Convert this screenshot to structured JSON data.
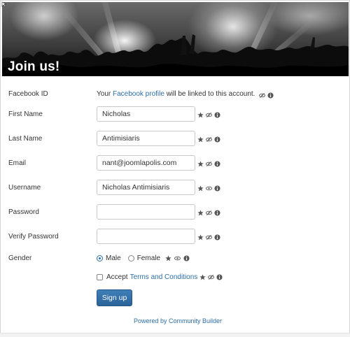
{
  "header": {
    "title": "Join us!",
    "back_icon": "back-arrow-icon"
  },
  "form": {
    "facebook": {
      "label": "Facebook ID",
      "prefix": "Your ",
      "link": "Facebook profile",
      "suffix": " will be linked to this account."
    },
    "fields": [
      {
        "label": "First Name",
        "value": "Nicholas"
      },
      {
        "label": "Last Name",
        "value": "Antimisiaris"
      },
      {
        "label": "Email",
        "value": "nant@joomlapolis.com"
      },
      {
        "label": "Username",
        "value": "Nicholas Antimisiaris"
      },
      {
        "label": "Password",
        "value": ""
      },
      {
        "label": "Verify Password",
        "value": ""
      }
    ],
    "gender": {
      "label": "Gender",
      "options": [
        "Male",
        "Female"
      ],
      "selected": "Male"
    },
    "terms": {
      "prefix": "Accept ",
      "link": "Terms and Conditions"
    },
    "submit_label": "Sign up"
  },
  "footer": {
    "powered": "Powered by Community Builder"
  },
  "colors": {
    "link": "#2d6da3",
    "button": "#2b639a"
  }
}
